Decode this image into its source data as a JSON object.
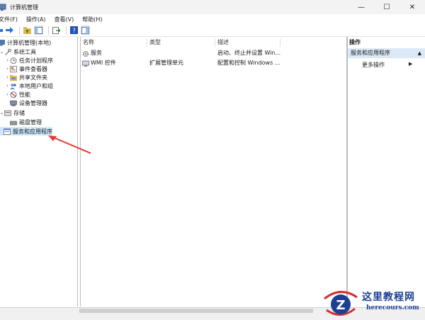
{
  "window": {
    "title": "计算机管理",
    "buttons": {
      "minimize": "—",
      "maximize": "☐",
      "close": "✕"
    }
  },
  "menu": [
    "文件(F)",
    "操作(A)",
    "查看(V)",
    "帮助(H)"
  ],
  "tree": {
    "root": "计算机管理(本地)",
    "system_tools": "系统工具",
    "task_scheduler": "任务计划程序",
    "event_viewer": "事件查看器",
    "shared_folders": "共享文件夹",
    "local_users": "本地用户和组",
    "performance": "性能",
    "device_manager": "设备管理器",
    "storage": "存储",
    "disk_management": "磁盘管理",
    "services_apps": "服务和应用程序"
  },
  "list": {
    "headers": {
      "name": "名称",
      "type": "类型",
      "desc": "描述"
    },
    "rows": [
      {
        "name": "服务",
        "type": "",
        "desc": "启动、终止并设置 Win..."
      },
      {
        "name": "WMI 控件",
        "type": "扩展管理单元",
        "desc": "配置和控制 Windows ..."
      }
    ]
  },
  "actions": {
    "header": "操作",
    "section": "服务和应用程序",
    "section_arrow": "▲",
    "more": "更多操作",
    "more_arrow": "▶"
  },
  "watermark": {
    "line1": "这里教程网",
    "line2": "herecours.com"
  },
  "colors": {
    "selection": "#cce8ff",
    "action_section": "#dbe9f7",
    "annotation_arrow": "#e53935",
    "watermark_blue": "#1c3f94",
    "watermark_red": "#d32f2f"
  }
}
